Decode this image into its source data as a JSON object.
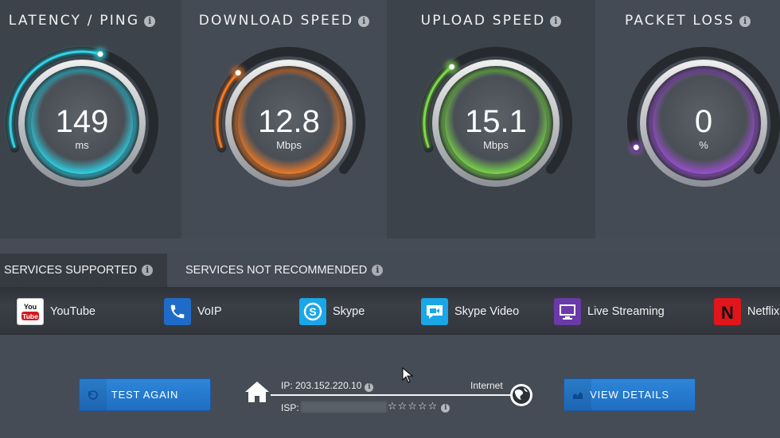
{
  "gauges": [
    {
      "title": "LATENCY / PING",
      "value": "149",
      "unit": "ms",
      "color": "#2ed3e6",
      "fraction": 0.52
    },
    {
      "title": "DOWNLOAD SPEED",
      "value": "12.8",
      "unit": "Mbps",
      "color": "#f07a26",
      "fraction": 0.27
    },
    {
      "title": "UPLOAD SPEED",
      "value": "15.1",
      "unit": "Mbps",
      "color": "#7bd84a",
      "fraction": 0.3
    },
    {
      "title": "PACKET LOSS",
      "value": "0",
      "unit": "%",
      "color": "#9a4fd0",
      "fraction": 0.0
    }
  ],
  "tabs": {
    "supported": "SERVICES SUPPORTED",
    "not_recommended": "SERVICES NOT RECOMMENDED"
  },
  "services": [
    {
      "label": "YouTube",
      "icon": "youtube-icon",
      "color": "#ffffff"
    },
    {
      "label": "VoIP",
      "icon": "phone-icon",
      "color": "#1f6cc8"
    },
    {
      "label": "Skype",
      "icon": "skype-icon",
      "color": "#1aa7e8"
    },
    {
      "label": "Skype Video",
      "icon": "video-chat-icon",
      "color": "#1aa7e8"
    },
    {
      "label": "Live Streaming",
      "icon": "monitor-icon",
      "color": "#6a3aa8"
    },
    {
      "label": "Netflix",
      "icon": "netflix-icon",
      "color": "#e0161c"
    }
  ],
  "buttons": {
    "test_again": "TEST AGAIN",
    "view_details": "VIEW DETAILS"
  },
  "connection": {
    "ip": "IP: 203.152.220.10",
    "internet": "Internet",
    "isp_label": "ISP:",
    "rating": "☆☆☆☆☆"
  }
}
